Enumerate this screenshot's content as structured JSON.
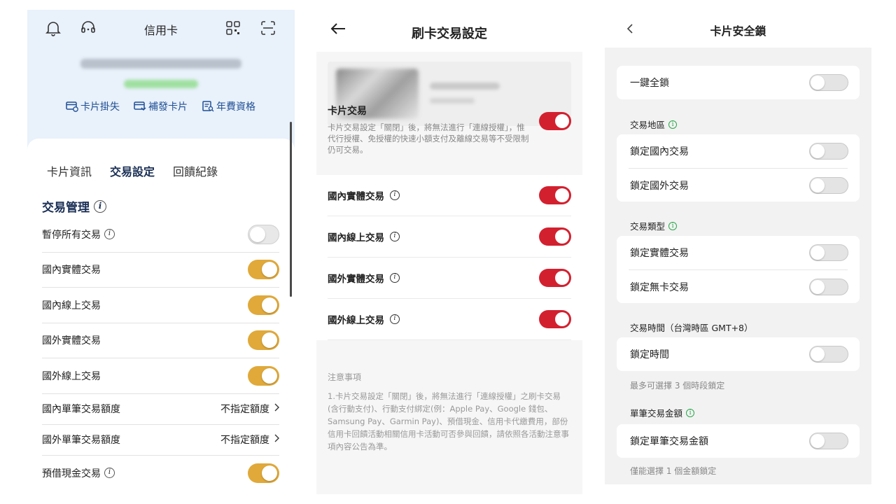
{
  "panel1": {
    "header": {
      "title": "信用卡"
    },
    "quick_actions": [
      "卡片掛失",
      "補發卡片",
      "年費資格"
    ],
    "tabs": [
      "卡片資訊",
      "交易設定",
      "回饋紀錄"
    ],
    "active_tab": "交易設定",
    "section_title": "交易管理",
    "rows": [
      {
        "label": "暫停所有交易",
        "info": true,
        "control": "toggle",
        "on": false
      },
      {
        "label": "國內實體交易",
        "info": false,
        "control": "toggle",
        "on": true
      },
      {
        "label": "國內線上交易",
        "info": false,
        "control": "toggle",
        "on": true
      },
      {
        "label": "國外實體交易",
        "info": false,
        "control": "toggle",
        "on": true
      },
      {
        "label": "國外線上交易",
        "info": false,
        "control": "toggle",
        "on": true
      },
      {
        "label": "國內單筆交易額度",
        "info": false,
        "control": "value",
        "value": "不指定額度"
      },
      {
        "label": "國外單筆交易額度",
        "info": false,
        "control": "value",
        "value": "不指定額度"
      },
      {
        "label": "預借現金交易",
        "info": true,
        "control": "toggle",
        "on": true
      }
    ],
    "colors": {
      "toggle_on": "#e0a93a",
      "accent": "#1f4f94"
    }
  },
  "panel2": {
    "header": {
      "title": "刷卡交易設定"
    },
    "main_toggle": {
      "label": "卡片交易",
      "description": "卡片交易設定「關閉」後，將無法進行「連線授權」，惟代行授權、免授權的快速小額支付及離線交易等不受限制仍可交易。",
      "on": true
    },
    "rows": [
      {
        "label": "國內實體交易",
        "on": true
      },
      {
        "label": "國內線上交易",
        "on": true
      },
      {
        "label": "國外實體交易",
        "on": true
      },
      {
        "label": "國外線上交易",
        "on": true
      }
    ],
    "notes": {
      "heading": "注意事項",
      "text": "1.卡片交易設定「關閉」後，將無法進行「連線授權」之刷卡交易(含行動支付)、行動支付綁定(例：Apple Pay、Google 錢包、Samsung Pay、Garmin Pay)、預借現金、信用卡代繳費用，部份信用卡回饋活動相關信用卡活動可否參與回饋，請依照各活動注意事項內容公告為準。"
    },
    "colors": {
      "toggle_on": "#d3202f"
    }
  },
  "panel3": {
    "header": {
      "title": "卡片安全鎖"
    },
    "one_key_lock": {
      "label": "一鍵全鎖",
      "on": false
    },
    "region": {
      "title": "交易地區",
      "rows": [
        {
          "label": "鎖定國內交易",
          "on": false
        },
        {
          "label": "鎖定國外交易",
          "on": false
        }
      ]
    },
    "type": {
      "title": "交易類型",
      "rows": [
        {
          "label": "鎖定實體交易",
          "on": false
        },
        {
          "label": "鎖定無卡交易",
          "on": false
        }
      ]
    },
    "time": {
      "title": "交易時間（台灣時區 GMT+8）",
      "rows": [
        {
          "label": "鎖定時間",
          "on": false
        }
      ],
      "hint": "最多可選擇 3 個時段鎖定"
    },
    "amount": {
      "title": "單筆交易金額",
      "rows": [
        {
          "label": "鎖定單筆交易金額",
          "on": false
        }
      ],
      "hint": "僅能選擇 1 個金額鎖定"
    },
    "colors": {
      "info_icon": "#2aa84a"
    }
  }
}
